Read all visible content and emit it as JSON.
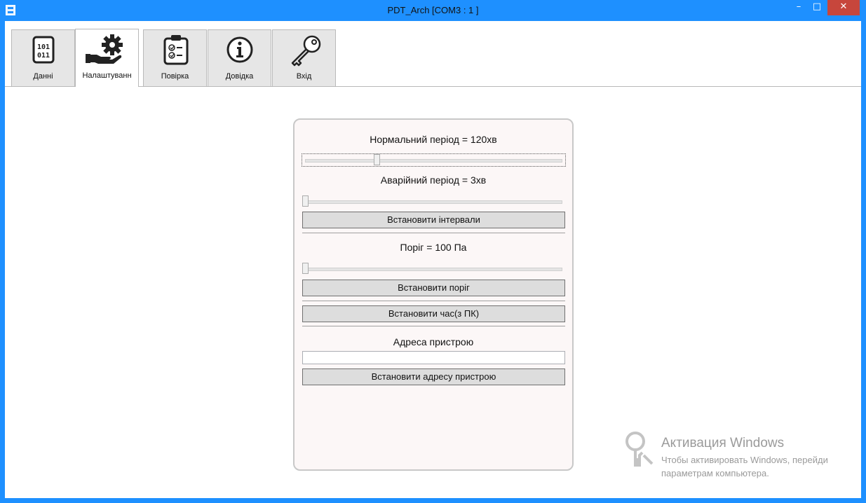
{
  "window": {
    "title": "PDT_Arch [COM3 : 1 ]",
    "minimize_glyph": "–",
    "maximize_glyph": "□",
    "close_glyph": "✕",
    "accent_color": "#1e90ff",
    "close_color": "#c7463c"
  },
  "tabs": [
    {
      "label": "Данні",
      "icon": "binary-file-icon",
      "active": false
    },
    {
      "label": "Налаштуванн",
      "icon": "hand-gear-icon",
      "active": true
    },
    {
      "label": "Повірка",
      "icon": "clipboard-checklist-icon",
      "active": false
    },
    {
      "label": "Довідка",
      "icon": "info-icon",
      "active": false
    },
    {
      "label": "Вхід",
      "icon": "key-icon",
      "active": false
    }
  ],
  "settings": {
    "normal_period_label": "Нормальний період = 120хв",
    "normal_period_position": 0.28,
    "alarm_period_label": "Аварійний період = 3хв",
    "alarm_period_position": 0.0,
    "set_intervals_button": "Встановити інтервали",
    "threshold_label": "Поріг = 100 Па",
    "threshold_position": 0.0,
    "set_threshold_button": "Встановити поріг",
    "set_time_button": "Встановити час(з ПК)",
    "device_address_label": "Адреса пристрою",
    "device_address_value": "",
    "set_address_button": "Встановити адресу пристрою"
  },
  "watermark": {
    "line1": "Активация Windows",
    "line2": "Чтобы активировать Windows, перейди",
    "line3": "параметрам компьютера."
  }
}
